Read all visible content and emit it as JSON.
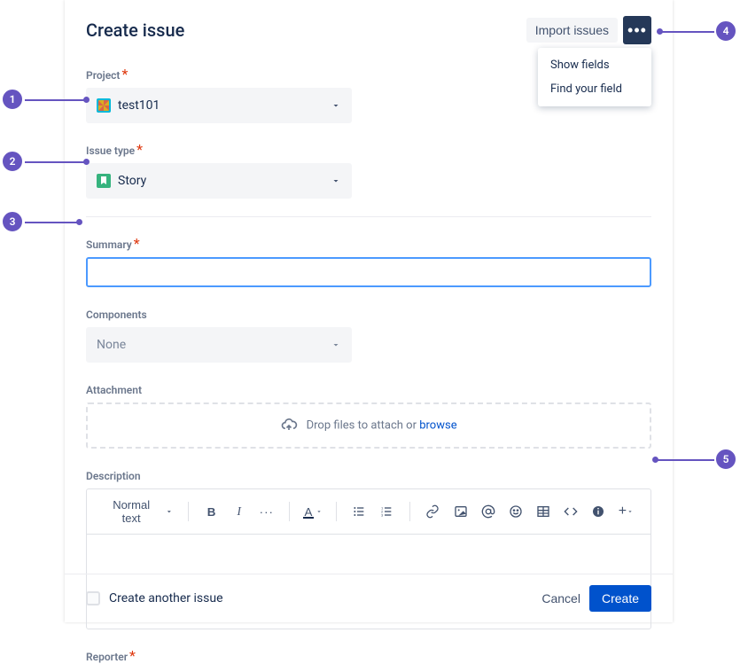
{
  "header": {
    "title": "Create issue",
    "import_label": "Import issues"
  },
  "dropdown": {
    "item1": "Show fields",
    "item2": "Find your field"
  },
  "project": {
    "label": "Project",
    "value": "test101"
  },
  "issue_type": {
    "label": "Issue type",
    "value": "Story"
  },
  "summary": {
    "label": "Summary",
    "value": ""
  },
  "components": {
    "label": "Components",
    "value": "None"
  },
  "attachment": {
    "label": "Attachment",
    "drop_text": "Drop files to attach or ",
    "browse": "browse"
  },
  "description": {
    "label": "Description",
    "text_style": "Normal text"
  },
  "reporter": {
    "label": "Reporter"
  },
  "footer": {
    "create_another": "Create another issue",
    "cancel": "Cancel",
    "create": "Create"
  },
  "callouts": {
    "c1": "1",
    "c2": "2",
    "c3": "3",
    "c4": "4",
    "c5": "5"
  },
  "colors": {
    "primary": "#0052CC",
    "callout": "#6554C0",
    "text": "#172B4D",
    "subtle": "#6B778C",
    "danger": "#DE350B"
  }
}
